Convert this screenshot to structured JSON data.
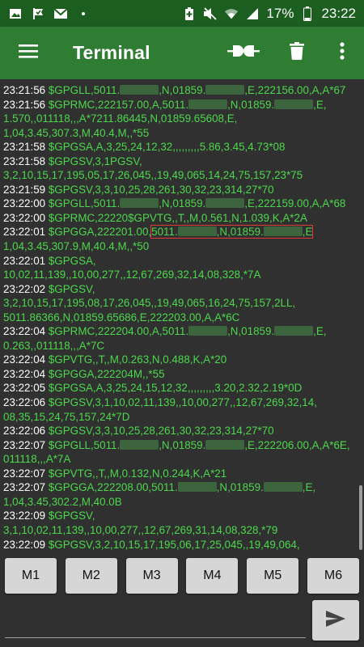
{
  "status_bar": {
    "battery_percent": "17%",
    "time": "23:22",
    "left_icons": [
      "image-icon",
      "check-flag-icon",
      "gmail-icon",
      "dot-icon"
    ],
    "right_icons": [
      "battery-saver-icon",
      "mute-icon",
      "wifi-icon",
      "signal-icon",
      "battery-icon"
    ]
  },
  "appbar": {
    "title": "Terminal",
    "icons": [
      "menu-icon",
      "connect-icon",
      "delete-icon",
      "more-vert-icon"
    ]
  },
  "colors": {
    "status_bar": "#1b5e20",
    "appbar": "#2e7d32",
    "terminal_bg": "#303030",
    "text_green": "#4cd84c",
    "timestamp": "#ffffff",
    "highlight_box": "#e53935"
  },
  "terminal": {
    "lines": [
      {
        "ts": "23:21:56",
        "parts": [
          "$GPGLL,5011.",
          "#",
          ",N,01859.",
          "#",
          ",E,222156.00,A,A*67"
        ]
      },
      {
        "ts": "23:21:56",
        "parts": [
          "$GPRMC,222157.00,A,5011.",
          "#",
          ",N,01859.",
          "#",
          ",E,"
        ]
      },
      {
        "ts": "",
        "parts": [
          "1.570,,011118,,,A*7211.86445,N,01859.65608,E,"
        ]
      },
      {
        "ts": "",
        "parts": [
          "1,04,3.45,307.3,M,40.4,M,,*55"
        ]
      },
      {
        "ts": "23:21:58",
        "parts": [
          "$GPGSA,A,3,25,24,12,32,,,,,,,,,5.86,3.45,4.73*08"
        ]
      },
      {
        "ts": "23:21:58",
        "parts": [
          "$GPGSV,3,1PGSV,"
        ]
      },
      {
        "ts": "",
        "parts": [
          "3,2,10,15,17,195,05,17,26,045,,19,49,065,14,24,75,157,23*75"
        ]
      },
      {
        "ts": "23:21:59",
        "parts": [
          "$GPGSV,3,3,10,25,28,261,30,32,23,314,27*70"
        ]
      },
      {
        "ts": "23:22:00",
        "parts": [
          "$GPGLL,5011.",
          "#",
          ",N,01859.",
          "#",
          ",E,222159.00,A,A*68"
        ]
      },
      {
        "ts": "23:22:00",
        "parts": [
          "$GPRMC,22220$GPVTG,,T,,M,0.561,N,1.039,K,A*2A"
        ]
      },
      {
        "ts": "23:22:01",
        "parts": [
          "$GPGGA,222201.00,",
          "[5011.",
          "#",
          ",N,01859.",
          "#",
          ",E]",
          ""
        ]
      },
      {
        "ts": "",
        "parts": [
          "1,04,3.45,307.9,M,40.4,M,,*50"
        ]
      },
      {
        "ts": "23:22:01",
        "parts": [
          "$GPGSA,"
        ]
      },
      {
        "ts": "",
        "parts": [
          "10,02,11,139,,10,00,277,,12,67,269,32,14,08,328,*7A"
        ]
      },
      {
        "ts": "23:22:02",
        "parts": [
          "$GPGSV,"
        ]
      },
      {
        "ts": "",
        "parts": [
          "3,2,10,15,17,195,08,17,26,045,,19,49,065,16,24,75,157,2LL,"
        ]
      },
      {
        "ts": "",
        "parts": [
          "5011.86366,N,01859.65686,E,222203.00,A,A*6C"
        ]
      },
      {
        "ts": "23:22:04",
        "parts": [
          "$GPRMC,222204.00,A,5011.",
          "#",
          ",N,01859.",
          "#",
          ",E,"
        ]
      },
      {
        "ts": "",
        "parts": [
          "0.263,,011118,,,A*7C"
        ]
      },
      {
        "ts": "23:22:04",
        "parts": [
          "$GPVTG,,T,,M,0.263,N,0.488,K,A*20"
        ]
      },
      {
        "ts": "23:22:04",
        "parts": [
          "$GPGGA,222204M,,*55"
        ]
      },
      {
        "ts": "23:22:05",
        "parts": [
          "$GPGSA,A,3,25,24,15,12,32,,,,,,,,,3.20,2.32,2.19*0D"
        ]
      },
      {
        "ts": "23:22:06",
        "parts": [
          "$GPGSV,3,1,10,02,11,139,,10,00,277,,12,67,269,32,14,"
        ]
      },
      {
        "ts": "",
        "parts": [
          "08,35,15,24,75,157,24*7D"
        ]
      },
      {
        "ts": "23:22:06",
        "parts": [
          "$GPGSV,3,3,10,25,28,261,30,32,23,314,27*70"
        ]
      },
      {
        "ts": "23:22:07",
        "parts": [
          "$GPGLL,5011.",
          "#",
          ",N,01859.",
          "#",
          ",E,222206.00,A,A*6E,"
        ]
      },
      {
        "ts": "",
        "parts": [
          "011118,,,A*7A"
        ]
      },
      {
        "ts": "23:22:07",
        "parts": [
          "$GPVTG,,T,,M,0.132,N,0.244,K,A*21"
        ]
      },
      {
        "ts": "23:22:07",
        "parts": [
          "$GPGGA,222208.00,5011.",
          "#",
          ",N,01859.",
          "#",
          ",E,"
        ]
      },
      {
        "ts": "",
        "parts": [
          "1,04,3.45,302.2,M,40.0B"
        ]
      },
      {
        "ts": "23:22:09",
        "parts": [
          "$GPGSV,"
        ]
      },
      {
        "ts": "",
        "parts": [
          "3,1,10,02,11,139,,10,00,277,,12,67,269,31,14,08,328,*79"
        ]
      },
      {
        "ts": "23:22:09",
        "parts": [
          "$GPGSV,3,2,10,15,17,195,06,17,25,045,,19,49,064,"
        ]
      }
    ]
  },
  "macros": [
    "M1",
    "M2",
    "M3",
    "M4",
    "M5",
    "M6"
  ],
  "input": {
    "value": "",
    "placeholder": ""
  }
}
